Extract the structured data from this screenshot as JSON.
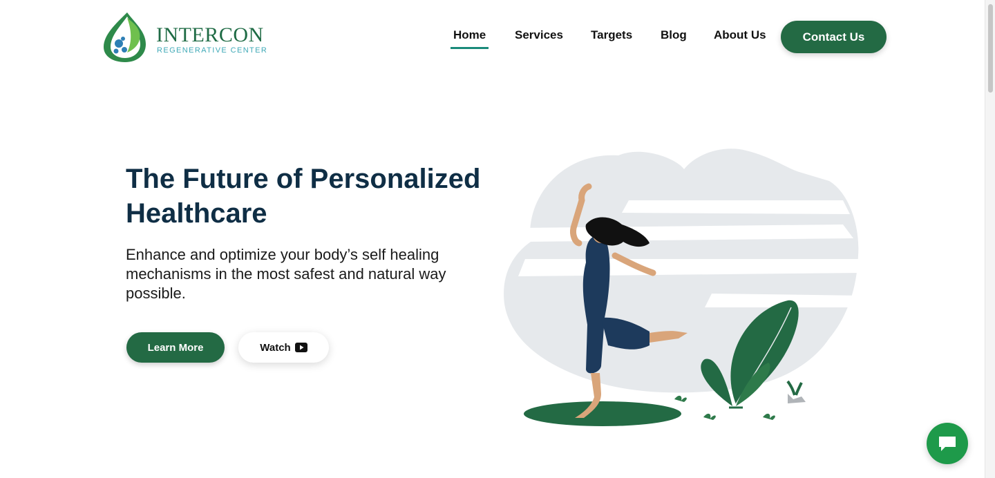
{
  "brand": {
    "name": "INTERCON",
    "tagline": "REGENERATIVE CENTER",
    "primary_color": "#236a44",
    "accent_color": "#1a8a7a"
  },
  "nav": {
    "items": [
      {
        "label": "Home",
        "active": true
      },
      {
        "label": "Services",
        "active": false
      },
      {
        "label": "Targets",
        "active": false
      },
      {
        "label": "Blog",
        "active": false
      },
      {
        "label": "About Us",
        "active": false
      }
    ],
    "contact_label": "Contact Us"
  },
  "hero": {
    "title": "The Future of Personalized Healthcare",
    "subtitle": "Enhance and optimize your body’s self healing mechanisms in the most safest and natural way possible.",
    "learn_more_label": "Learn More",
    "watch_label": "Watch",
    "watch_icon": "youtube-play-icon"
  },
  "illustration": {
    "icon": "dancing-woman-with-plant"
  },
  "chat": {
    "icon": "chat-bubble-icon"
  }
}
